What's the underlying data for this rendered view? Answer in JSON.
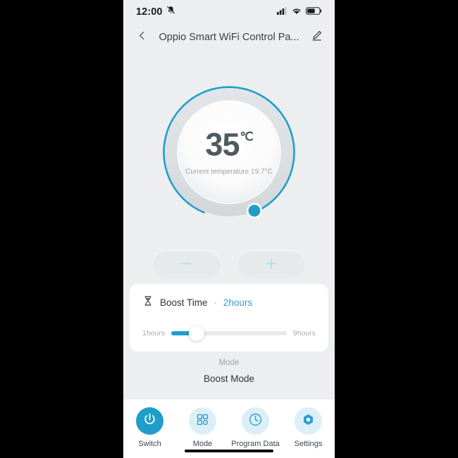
{
  "status_bar": {
    "time": "12:00",
    "mute_icon": "bell-muted-icon",
    "signal_icon": "cellular-signal-icon",
    "wifi_icon": "wifi-icon",
    "battery_icon": "battery-icon"
  },
  "header": {
    "back_icon": "chevron-left-icon",
    "title": "Oppio Smart WiFi Control Pa...",
    "edit_icon": "pencil-edit-icon"
  },
  "dial": {
    "target_temperature": "35",
    "unit": "℃",
    "current_temperature_text": "Current temperature 19.7°C",
    "arc_color": "#1f9ec9",
    "track_color": "#dfe2e5",
    "handle_name": "dial-handle"
  },
  "adjust": {
    "decrease_icon": "minus-icon",
    "increase_icon": "plus-icon",
    "icon_color": "#aedbec"
  },
  "boost": {
    "icon": "hourglass-icon",
    "label": "Boost Time",
    "separator": "·",
    "value": "2hours",
    "slider": {
      "min_label": "1hours",
      "max_label": "9hours",
      "fill_color": "#1f9ec9"
    }
  },
  "mode": {
    "caption": "Mode",
    "value": "Boost Mode"
  },
  "bottom_nav": {
    "items": [
      {
        "label": "Switch",
        "icon": "power-icon",
        "active": true
      },
      {
        "label": "Mode",
        "icon": "grid-icon",
        "active": false
      },
      {
        "label": "Program Data",
        "icon": "clock-icon",
        "active": false
      },
      {
        "label": "Settings",
        "icon": "hexagon-nut-icon",
        "active": false
      }
    ],
    "active_color": "#1f9ec9",
    "inactive_bg": "#ddeff6"
  }
}
